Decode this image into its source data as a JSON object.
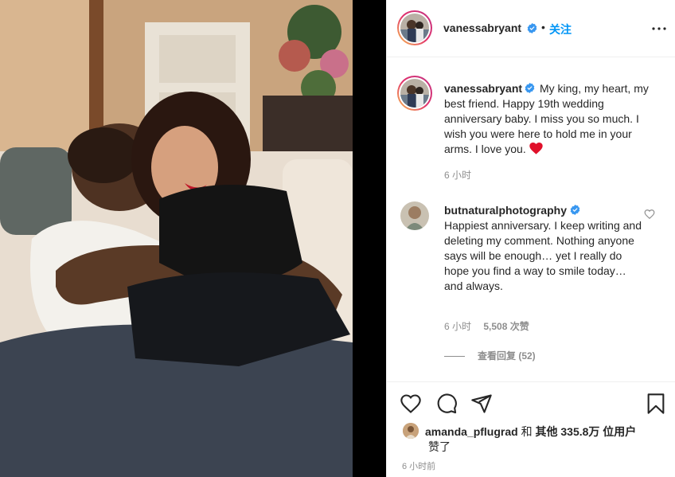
{
  "post": {
    "username": "vanessabryant",
    "dot": "•",
    "follow_label": "关注",
    "photo_alt": "Couple embracing on a couch",
    "caption": {
      "username": "vanessabryant",
      "text": "My king, my heart, my best friend. Happy 19th wedding anniversary baby. I miss you so much. I wish you were here to hold me in your arms. I love you.",
      "emoji": "❤️",
      "time": "6 小时"
    },
    "comment": {
      "username": "butnaturalphotography",
      "text": "Happiest anniversary. I keep writing and deleting my comment. Nothing anyone says will be enough… yet I really do hope you find a way to smile today… and always.",
      "time": "6 小时",
      "likes": "5,508 次赞",
      "view_replies": "查看回复 (52)"
    },
    "likes": {
      "user": "amanda_pflugrad",
      "and": "和",
      "others": "其他 335.8万 位用户",
      "suffix": "赞了"
    },
    "posted": "6 小时前"
  },
  "icons": {
    "more": "more-options-icon",
    "verified": "verified-badge-icon",
    "like": "heart-icon",
    "comment": "comment-icon",
    "share": "share-icon",
    "save": "bookmark-icon"
  },
  "colors": {
    "link": "#0095f6",
    "verified": "#3897f0",
    "heart": "#ed4956",
    "muted": "#8e8e8e",
    "text": "#262626"
  }
}
